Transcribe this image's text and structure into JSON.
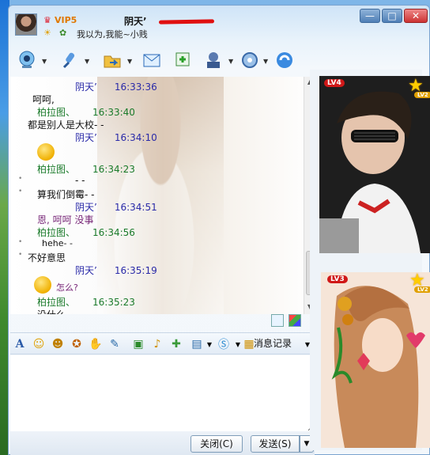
{
  "titlebar": {
    "vip_label": "VIP5",
    "name": "阴天’",
    "signature": "我以为,我能~小贱",
    "controls": [
      "—",
      "□",
      "✕"
    ]
  },
  "toolbar": {
    "icons": [
      "webcam-icon",
      "voice-icon",
      "file-transfer-icon",
      "email-icon",
      "create-group-icon",
      "remote-assist-icon",
      "settings-icon",
      "app-icon"
    ]
  },
  "messages": [
    {
      "sender": "阴天’",
      "time": "16:33:36",
      "text": "呵呵,",
      "color": "blue"
    },
    {
      "sender": "柏拉图、",
      "time": "16:33:40",
      "text": "都是别人是大校- -",
      "color": "green"
    },
    {
      "sender": "阴天’",
      "time": "16:34:10",
      "text": "",
      "color": "blue"
    },
    {
      "sender": "柏拉图、",
      "time": "16:34:23",
      "text": "- -",
      "color": "green"
    },
    {
      "sender": "",
      "time": "",
      "text": "算我们倒霉- -",
      "color": ""
    },
    {
      "sender": "阴天’",
      "time": "16:34:51",
      "text": "恩, 呵呵 没事",
      "color": "blue"
    },
    {
      "sender": "柏拉图、",
      "time": "16:34:56",
      "text": "hehe- -",
      "color": "green"
    },
    {
      "sender": "",
      "time": "",
      "text": "不好意思",
      "color": ""
    },
    {
      "sender": "阴天’",
      "time": "16:35:19",
      "text": "怎么?",
      "color": "blue"
    },
    {
      "sender": "柏拉图、",
      "time": "16:35:23",
      "text": "没什么~",
      "color": "green"
    }
  ],
  "format_bar": {
    "history_label": "消息记录"
  },
  "buttons": {
    "close": "关闭(C)",
    "send": "发送(S)",
    "send_dropdown": "▼"
  },
  "right": {
    "level1": "LV4",
    "level2": "LV3",
    "lv_small": "LV2"
  },
  "colors": {
    "sender_blue": "#2a2aa8",
    "sender_green": "#1a7a2a",
    "accent_red": "#d01818"
  }
}
